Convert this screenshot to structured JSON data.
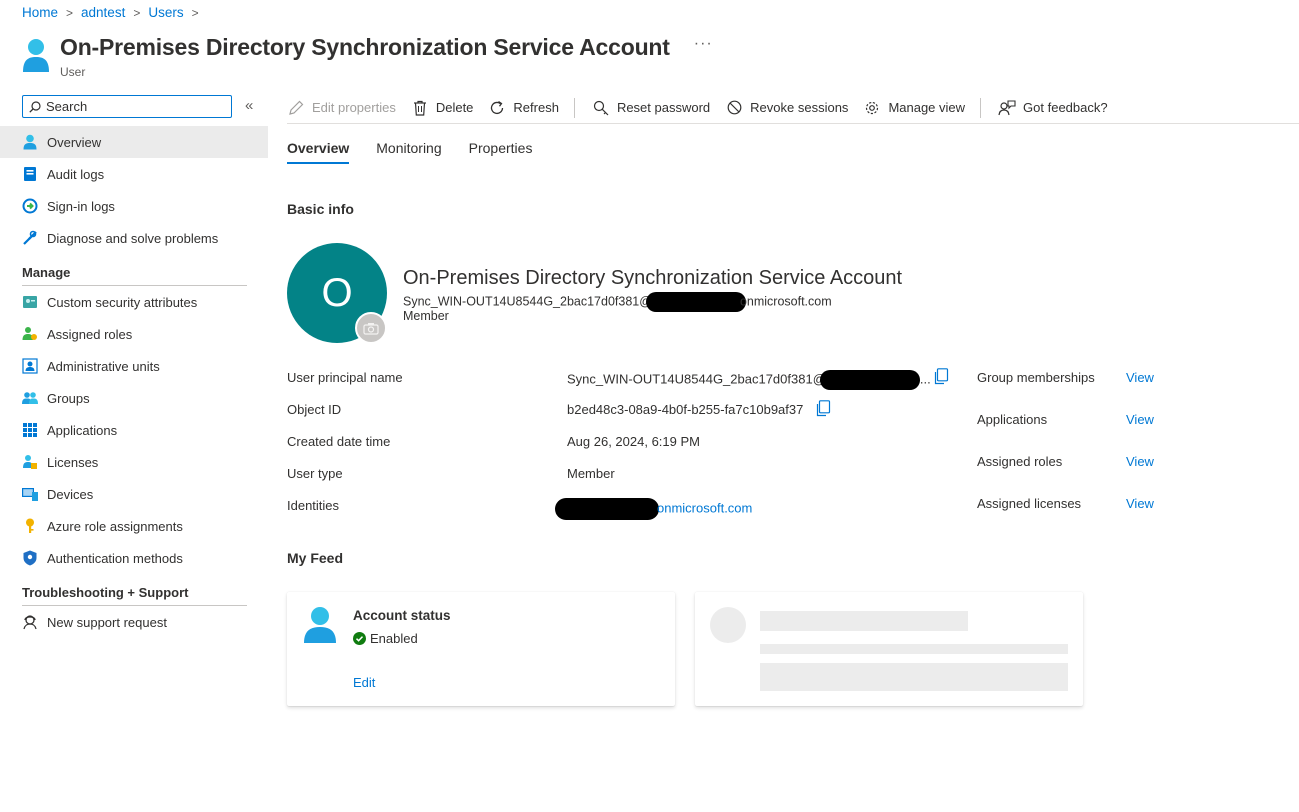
{
  "breadcrumb": {
    "home": "Home",
    "tenant": "adntest",
    "users": "Users",
    "sep": ">"
  },
  "header": {
    "title": "On-Premises Directory Synchronization Service Account",
    "subtitle": "User",
    "more": "···"
  },
  "sidebar": {
    "search_placeholder": "Search",
    "collapse": "«",
    "items": [
      {
        "label": "Overview",
        "icon": "user-icon"
      },
      {
        "label": "Audit logs",
        "icon": "audit-log-icon"
      },
      {
        "label": "Sign-in logs",
        "icon": "sign-in-log-icon"
      },
      {
        "label": "Diagnose and solve problems",
        "icon": "wrench-icon"
      }
    ],
    "manage_heading": "Manage",
    "manage_items": [
      {
        "label": "Custom security attributes",
        "icon": "security-attributes-icon"
      },
      {
        "label": "Assigned roles",
        "icon": "roles-icon"
      },
      {
        "label": "Administrative units",
        "icon": "admin-units-icon"
      },
      {
        "label": "Groups",
        "icon": "groups-icon"
      },
      {
        "label": "Applications",
        "icon": "applications-icon"
      },
      {
        "label": "Licenses",
        "icon": "licenses-icon"
      },
      {
        "label": "Devices",
        "icon": "devices-icon"
      },
      {
        "label": "Azure role assignments",
        "icon": "key-icon"
      },
      {
        "label": "Authentication methods",
        "icon": "shield-icon"
      }
    ],
    "support_heading": "Troubleshooting + Support",
    "support_items": [
      {
        "label": "New support request",
        "icon": "support-icon"
      }
    ]
  },
  "toolbar": {
    "edit": "Edit properties",
    "delete": "Delete",
    "refresh": "Refresh",
    "reset_password": "Reset password",
    "revoke_sessions": "Revoke sessions",
    "manage_view": "Manage view",
    "feedback": "Got feedback?"
  },
  "tabs": [
    "Overview",
    "Monitoring",
    "Properties"
  ],
  "basic_info": {
    "heading": "Basic info",
    "avatar_initial": "O",
    "display_name": "On-Premises Directory Synchronization Service Account",
    "upn_prefix": "Sync_WIN-OUT14U8544G_2bac17d0f381@",
    "upn_suffix": "onmicrosoft.com",
    "user_type": "Member"
  },
  "properties": [
    {
      "label": "User principal name",
      "value": "Sync_WIN-OUT14U8544G_2bac17d0f381@"
    },
    {
      "label": "Object ID",
      "value": "b2ed48c3-08a9-4b0f-b255-fa7c10b9af37"
    },
    {
      "label": "Created date time",
      "value": "Aug 26, 2024, 6:19 PM"
    },
    {
      "label": "User type",
      "value": "Member"
    },
    {
      "label": "Identities",
      "value": "onmicrosoft.com"
    }
  ],
  "upn_ellipsis": "...",
  "summary": [
    {
      "label": "Group memberships",
      "link": "View"
    },
    {
      "label": "Applications",
      "link": "View"
    },
    {
      "label": "Assigned roles",
      "link": "View"
    },
    {
      "label": "Assigned licenses",
      "link": "View"
    }
  ],
  "my_feed": {
    "heading": "My Feed",
    "account_status_title": "Account status",
    "account_status_value": "Enabled",
    "edit_label": "Edit"
  },
  "colors": {
    "accent": "#0078d4",
    "avatar_bg": "#038387",
    "enabled_green": "#107c10"
  }
}
